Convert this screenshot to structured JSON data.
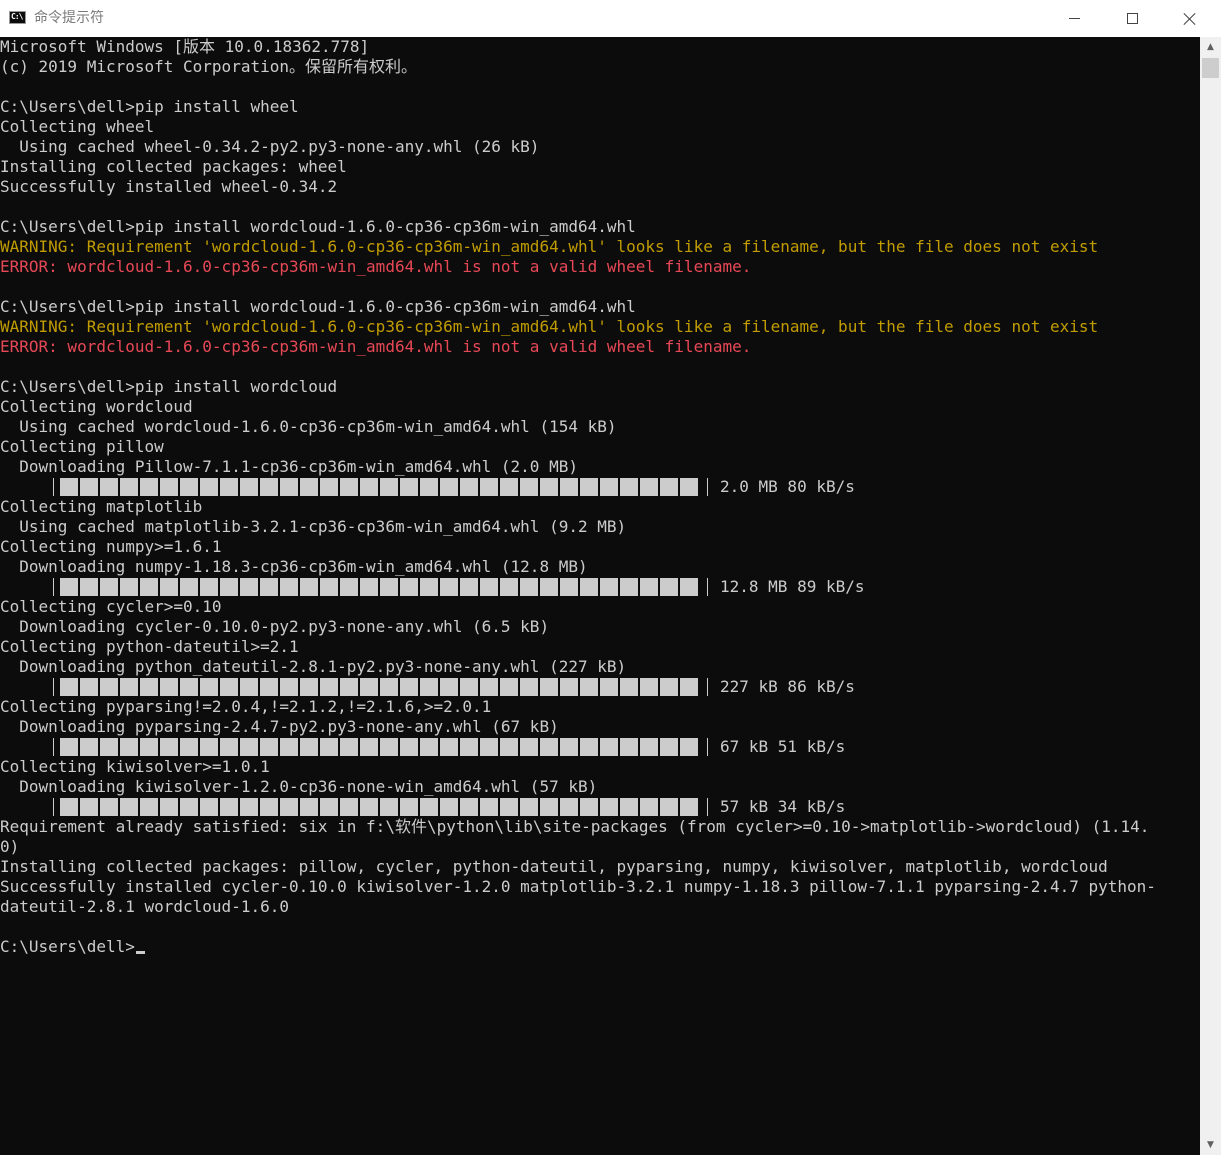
{
  "window": {
    "title": "命令提示符",
    "app_icon_text": "C:\\"
  },
  "console": {
    "lines": [
      {
        "text": "Microsoft Windows [版本 10.0.18362.778]",
        "color": "normal"
      },
      {
        "text": "(c) 2019 Microsoft Corporation。保留所有权利。",
        "color": "normal"
      },
      {
        "text": "",
        "color": "normal"
      },
      {
        "text": "C:\\Users\\dell>pip install wheel",
        "color": "normal"
      },
      {
        "text": "Collecting wheel",
        "color": "normal"
      },
      {
        "text": "  Using cached wheel-0.34.2-py2.py3-none-any.whl (26 kB)",
        "color": "normal"
      },
      {
        "text": "Installing collected packages: wheel",
        "color": "normal"
      },
      {
        "text": "Successfully installed wheel-0.34.2",
        "color": "normal"
      },
      {
        "text": "",
        "color": "normal"
      },
      {
        "text": "C:\\Users\\dell>pip install wordcloud-1.6.0-cp36-cp36m-win_amd64.whl",
        "color": "normal"
      },
      {
        "text": "WARNING: Requirement 'wordcloud-1.6.0-cp36-cp36m-win_amd64.whl' looks like a filename, but the file does not exist",
        "color": "warn"
      },
      {
        "text": "ERROR: wordcloud-1.6.0-cp36-cp36m-win_amd64.whl is not a valid wheel filename.",
        "color": "err"
      },
      {
        "text": "",
        "color": "normal"
      },
      {
        "text": "C:\\Users\\dell>pip install wordcloud-1.6.0-cp36-cp36m-win_amd64.whl",
        "color": "normal"
      },
      {
        "text": "WARNING: Requirement 'wordcloud-1.6.0-cp36-cp36m-win_amd64.whl' looks like a filename, but the file does not exist",
        "color": "warn"
      },
      {
        "text": "ERROR: wordcloud-1.6.0-cp36-cp36m-win_amd64.whl is not a valid wheel filename.",
        "color": "err"
      },
      {
        "text": "",
        "color": "normal"
      },
      {
        "text": "C:\\Users\\dell>pip install wordcloud",
        "color": "normal"
      },
      {
        "text": "Collecting wordcloud",
        "color": "normal"
      },
      {
        "text": "  Using cached wordcloud-1.6.0-cp36-cp36m-win_amd64.whl (154 kB)",
        "color": "normal"
      },
      {
        "text": "Collecting pillow",
        "color": "normal"
      },
      {
        "text": "  Downloading Pillow-7.1.1-cp36-cp36m-win_amd64.whl (2.0 MB)",
        "color": "normal"
      },
      {
        "progress": "2.0 MB 80 kB/s"
      },
      {
        "text": "Collecting matplotlib",
        "color": "normal"
      },
      {
        "text": "  Using cached matplotlib-3.2.1-cp36-cp36m-win_amd64.whl (9.2 MB)",
        "color": "normal"
      },
      {
        "text": "Collecting numpy>=1.6.1",
        "color": "normal"
      },
      {
        "text": "  Downloading numpy-1.18.3-cp36-cp36m-win_amd64.whl (12.8 MB)",
        "color": "normal"
      },
      {
        "progress": "12.8 MB 89 kB/s"
      },
      {
        "text": "Collecting cycler>=0.10",
        "color": "normal"
      },
      {
        "text": "  Downloading cycler-0.10.0-py2.py3-none-any.whl (6.5 kB)",
        "color": "normal"
      },
      {
        "text": "Collecting python-dateutil>=2.1",
        "color": "normal"
      },
      {
        "text": "  Downloading python_dateutil-2.8.1-py2.py3-none-any.whl (227 kB)",
        "color": "normal"
      },
      {
        "progress": "227 kB 86 kB/s"
      },
      {
        "text": "Collecting pyparsing!=2.0.4,!=2.1.2,!=2.1.6,>=2.0.1",
        "color": "normal"
      },
      {
        "text": "  Downloading pyparsing-2.4.7-py2.py3-none-any.whl (67 kB)",
        "color": "normal"
      },
      {
        "progress": "67 kB 51 kB/s"
      },
      {
        "text": "Collecting kiwisolver>=1.0.1",
        "color": "normal"
      },
      {
        "text": "  Downloading kiwisolver-1.2.0-cp36-none-win_amd64.whl (57 kB)",
        "color": "normal"
      },
      {
        "progress": "57 kB 34 kB/s"
      },
      {
        "text": "Requirement already satisfied: six in f:\\软件\\python\\lib\\site-packages (from cycler>=0.10->matplotlib->wordcloud) (1.14.",
        "color": "normal"
      },
      {
        "text": "0)",
        "color": "normal"
      },
      {
        "text": "Installing collected packages: pillow, cycler, python-dateutil, pyparsing, numpy, kiwisolver, matplotlib, wordcloud",
        "color": "normal"
      },
      {
        "text": "Successfully installed cycler-0.10.0 kiwisolver-1.2.0 matplotlib-3.2.1 numpy-1.18.3 pillow-7.1.1 pyparsing-2.4.7 python-",
        "color": "normal"
      },
      {
        "text": "dateutil-2.8.1 wordcloud-1.6.0",
        "color": "normal"
      },
      {
        "text": "",
        "color": "normal"
      }
    ],
    "prompt": "C:\\Users\\dell>",
    "progress_fraction": 1.0
  },
  "scrollbar": {
    "up_icon": "scroll-up-arrow-icon",
    "down_icon": "scroll-down-arrow-icon"
  },
  "colors": {
    "background": "#0c0c0c",
    "text": "#cccccc",
    "warning": "#c19c00",
    "error": "#e74856"
  }
}
